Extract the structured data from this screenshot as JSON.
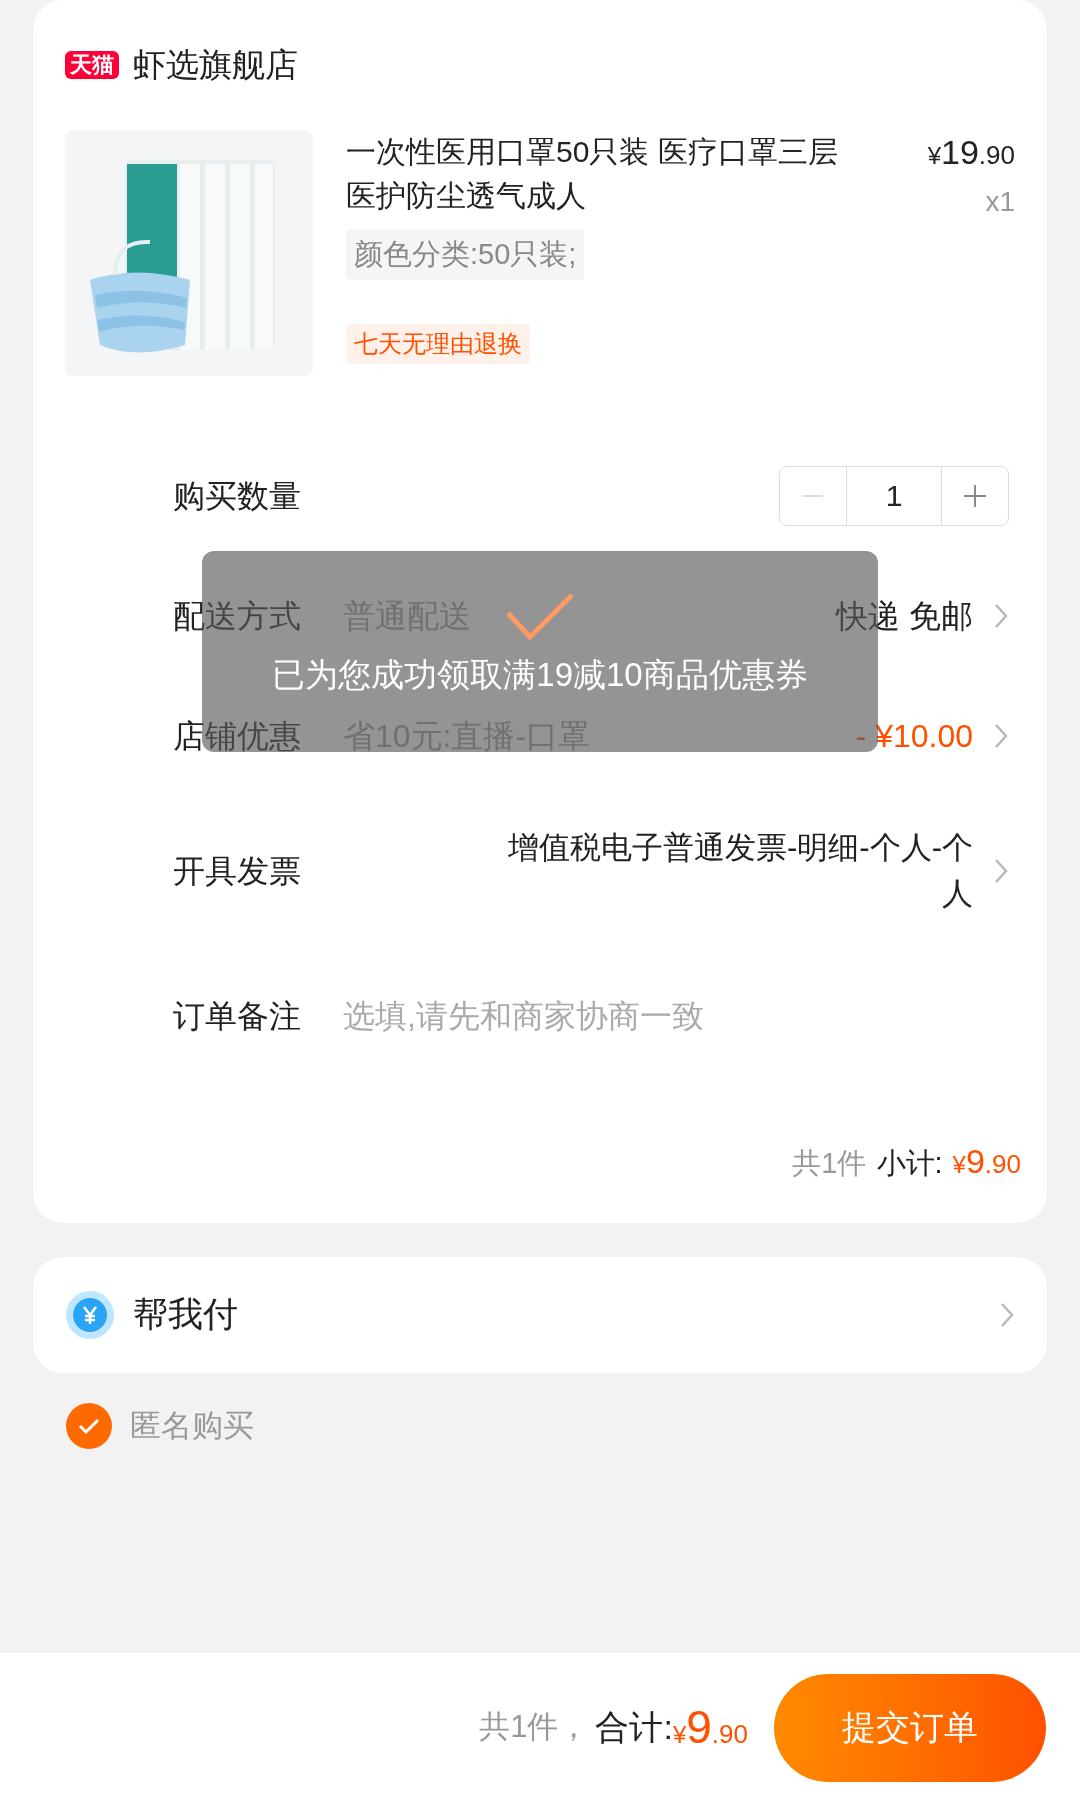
{
  "store": {
    "badge": "天猫",
    "name": "虾选旗舰店"
  },
  "product": {
    "title": "一次性医用口罩50只装 医疗口罩三层医护防尘透气成人",
    "price_symbol": "¥",
    "price_int": "19",
    "price_dec": ".90",
    "quantity": "x1",
    "spec": "颜色分类:50只装;",
    "tag": "七天无理由退换"
  },
  "quantity_row": {
    "label": "购买数量",
    "value": "1",
    "minus_disabled": true
  },
  "rows": [
    {
      "kind": "delivery",
      "label": "配送方式",
      "value": "普通配送",
      "right": "快递 免邮"
    },
    {
      "kind": "discount",
      "label": "店铺优惠",
      "value": "省10元:直播-口罩",
      "right": "- ¥10.00"
    },
    {
      "kind": "invoice",
      "label": "开具发票",
      "right": "增值税电子普通发票-明细-个人-个人"
    },
    {
      "kind": "note",
      "label": "订单备注",
      "placeholder": "选填,请先和商家协商一致"
    }
  ],
  "subtotal": {
    "count": "共1件",
    "label": "小计:",
    "symbol": "¥",
    "int": "9",
    "dec": ".90"
  },
  "pay_for_me": {
    "label": "帮我付"
  },
  "anonymous": {
    "label": "匿名购买",
    "checked": true
  },
  "footer": {
    "count": "共1件，",
    "label": "合计:",
    "symbol": "¥",
    "int": "9",
    "dec": ".90",
    "submit": "提交订单"
  },
  "toast": {
    "message": "已为您成功领取满19减10商品优惠券"
  }
}
